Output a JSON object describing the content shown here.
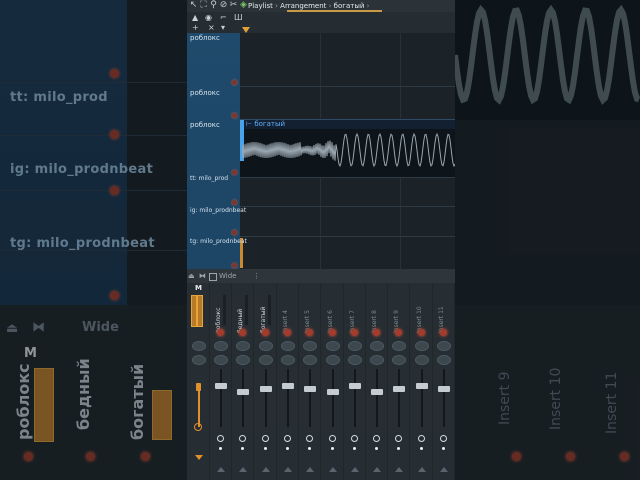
{
  "titlebar": {
    "breadcrumb": [
      "Playlist",
      "Arrangement",
      "богатый"
    ],
    "sep": "›",
    "toolbar_icons": [
      "arrow-icon",
      "select-icon",
      "zoom-icon",
      "mute-icon",
      "slice-icon"
    ],
    "short_label": "Ш"
  },
  "toolbar2": {
    "plus": "+",
    "close": "×",
    "caret": "▾"
  },
  "tracks": [
    {
      "name": "роблокс"
    },
    {
      "name": "роблокс"
    },
    {
      "name": "роблокс"
    },
    {
      "name": "tt: milo_prod"
    },
    {
      "name": "ig: milo_prodnbeat"
    },
    {
      "name": "tg: milo_prodnbeat"
    }
  ],
  "clip": {
    "title": "богатый",
    "head_icon": "clip-menu-icon"
  },
  "mixer": {
    "toolbar": {
      "label": "Wide"
    },
    "master_label": "M",
    "strips": [
      {
        "name": "роблокс",
        "dim": false
      },
      {
        "name": "бедный",
        "dim": false
      },
      {
        "name": "богатый",
        "dim": false
      },
      {
        "name": "Insert 4",
        "dim": true
      },
      {
        "name": "Insert 5",
        "dim": true
      },
      {
        "name": "Insert 6",
        "dim": true
      },
      {
        "name": "Insert 7",
        "dim": true
      },
      {
        "name": "Insert 8",
        "dim": true
      },
      {
        "name": "Insert 9",
        "dim": true
      },
      {
        "name": "Insert 10",
        "dim": true
      },
      {
        "name": "Insert 11",
        "dim": true
      }
    ]
  },
  "background": {
    "labels": [
      "tt: milo_prod",
      "ig: milo_prodnbeat",
      "tg: milo_prodnbeat"
    ],
    "mixer_label": "Wide",
    "master": "M",
    "rot_names": [
      "роблокс",
      "бедный",
      "богатый"
    ],
    "inserts": [
      "Insert 9",
      "Insert 10",
      "Insert 11"
    ]
  },
  "colors": {
    "accent_orange": "#e0902d",
    "clip_blue": "#5fb1ff",
    "track_blue": "#1f4a6b",
    "send_red": "#a33c2c"
  }
}
